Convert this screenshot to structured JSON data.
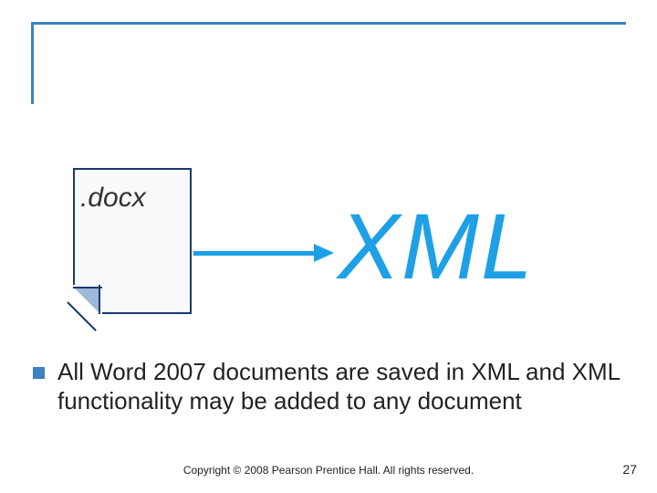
{
  "doc_label": ".docx",
  "xml_label": "XML",
  "bullet_text": "All Word 2007 documents are saved in XML and XML functionality may be added to any document",
  "copyright": "Copyright © 2008 Pearson Prentice Hall. All rights reserved.",
  "page_number": "27"
}
